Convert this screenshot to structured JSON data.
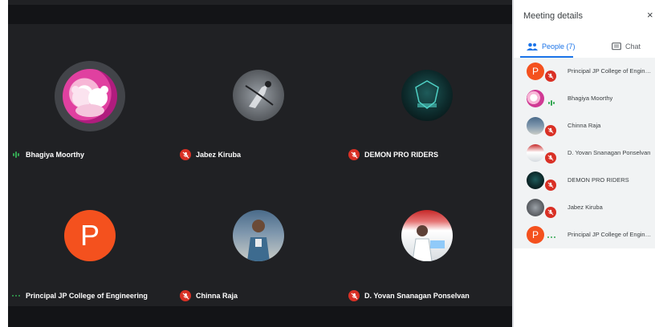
{
  "panel": {
    "title": "Meeting details",
    "close_symbol": "×",
    "tabs": [
      {
        "label": "People (7)",
        "active": true
      },
      {
        "label": "Chat",
        "active": false
      }
    ],
    "people": [
      {
        "name": "Principal JP College of Engine…",
        "avatar_letter": "P",
        "mic": "muted"
      },
      {
        "name": "Bhagiya Moorthy",
        "mic": "speaking"
      },
      {
        "name": "Chinna Raja",
        "mic": "muted"
      },
      {
        "name": "D. Yovan Snanagan Ponselvan",
        "mic": "muted"
      },
      {
        "name": "DEMON PRO RIDERS",
        "mic": "muted"
      },
      {
        "name": "Jabez Kiruba",
        "mic": "muted"
      },
      {
        "name": "Principal JP College of Engine…",
        "avatar_letter": "P",
        "mic": "more"
      }
    ]
  },
  "tiles": [
    {
      "name": "Bhagiya Moorthy",
      "mic": "speaking"
    },
    {
      "name": "Jabez Kiruba",
      "mic": "muted"
    },
    {
      "name": "DEMON PRO RIDERS",
      "mic": "muted"
    },
    {
      "name": "Principal JP College of Engineering",
      "avatar_letter": "P",
      "mic": "more"
    },
    {
      "name": "Chinna Raja",
      "mic": "muted"
    },
    {
      "name": "D. Yovan Snanagan Ponselvan",
      "mic": "muted"
    }
  ],
  "colors": {
    "stage_bg": "#202124",
    "bar_bg": "#131417",
    "mute_red": "#d93025",
    "speaking_green": "#34a853",
    "accent_blue": "#1a73e8",
    "avatar_orange": "#f4511e"
  }
}
